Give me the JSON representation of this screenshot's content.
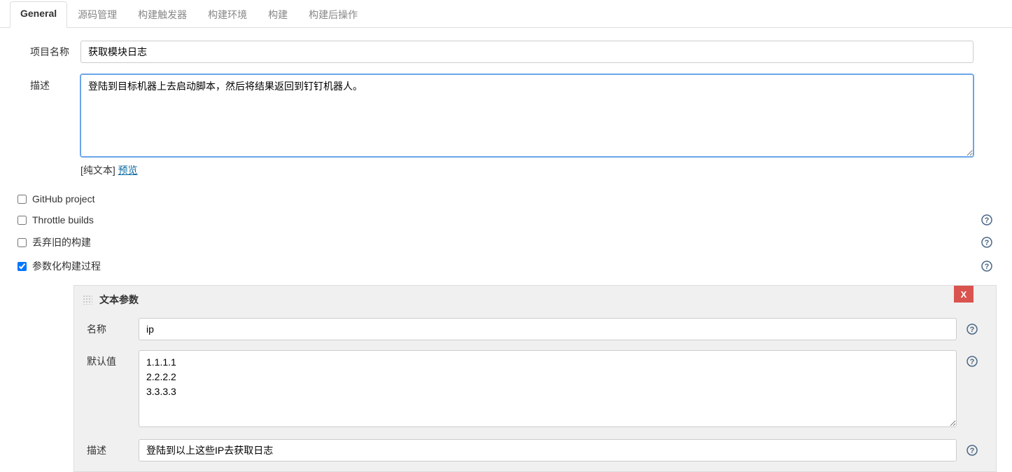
{
  "tabs": [
    {
      "label": "General",
      "active": true
    },
    {
      "label": "源码管理"
    },
    {
      "label": "构建触发器"
    },
    {
      "label": "构建环境"
    },
    {
      "label": "构建"
    },
    {
      "label": "构建后操作"
    }
  ],
  "labels": {
    "projectName": "项目名称",
    "description": "描述",
    "plainText": "[纯文本]",
    "preview": "预览"
  },
  "form": {
    "projectName": "获取模块日志",
    "description": "登陆到目标机器上去启动脚本，然后将结果返回到钉钉机器人。"
  },
  "checkboxes": {
    "githubProject": {
      "label": "GitHub project",
      "checked": false,
      "help": false
    },
    "throttleBuilds": {
      "label": "Throttle builds",
      "checked": false,
      "help": true
    },
    "discardOld": {
      "label": "丢弃旧的构建",
      "checked": false,
      "help": true
    },
    "parameterized": {
      "label": "参数化构建过程",
      "checked": true,
      "help": true
    }
  },
  "param": {
    "title": "文本参数",
    "deleteLabel": "X",
    "nameLabel": "名称",
    "nameValue": "ip",
    "defaultLabel": "默认值",
    "defaultValue": "1.1.1.1\n2.2.2.2\n3.3.3.3",
    "descLabel": "描述",
    "descValue": "登陆到以上这些IP去获取日志"
  },
  "colors": {
    "helpIcon": "#4a6785"
  }
}
